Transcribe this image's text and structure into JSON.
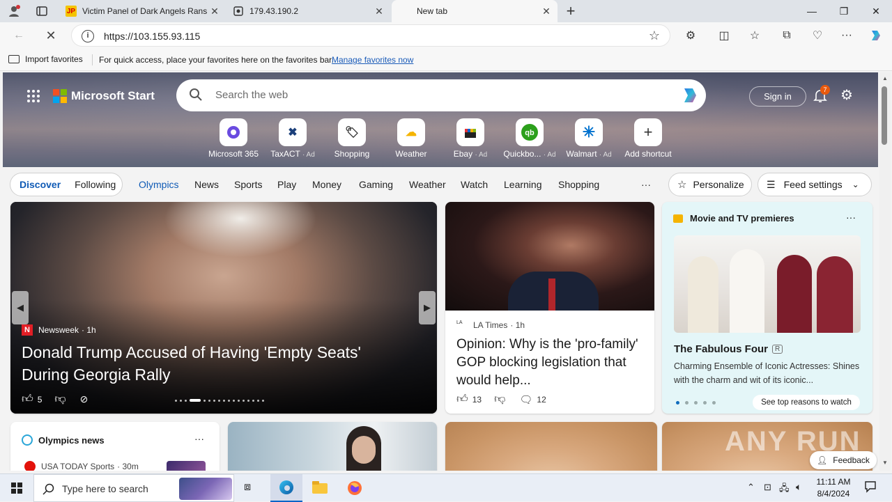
{
  "browser": {
    "tabs": [
      {
        "favicon": "JP",
        "title": "Victim Panel of Dark Angels Rans"
      },
      {
        "favicon": "site-icon",
        "title": "179.43.190.2"
      },
      {
        "favicon": "",
        "title": "New tab"
      }
    ],
    "new_tab_glyph": "+",
    "url": "https://103.155.93.115",
    "favbar": {
      "import_label": "Import favorites",
      "message": "For quick access, place your favorites here on the favorites bar.",
      "manage_link": "Manage favorites now"
    }
  },
  "start": {
    "brand": "Microsoft Start",
    "search_placeholder": "Search the web",
    "sign_in": "Sign in",
    "notification_count": "7",
    "quicklinks": [
      {
        "label": "Microsoft 365",
        "ad": ""
      },
      {
        "label": "TaxACT",
        "ad": "· Ad"
      },
      {
        "label": "Shopping",
        "ad": ""
      },
      {
        "label": "Weather",
        "ad": ""
      },
      {
        "label": "Ebay",
        "ad": "· Ad"
      },
      {
        "label": "Quickbo...",
        "ad": "· Ad"
      },
      {
        "label": "Walmart",
        "ad": "· Ad"
      },
      {
        "label": "Add shortcut",
        "ad": ""
      }
    ],
    "feed_tabs": {
      "discover": "Discover",
      "following": "Following"
    },
    "nav": [
      "Olympics",
      "News",
      "Sports",
      "Play",
      "Money",
      "Gaming",
      "Weather",
      "Watch",
      "Learning",
      "Shopping"
    ],
    "more": "···",
    "personalize": "Personalize",
    "feed_settings": "Feed settings"
  },
  "cards": {
    "main": {
      "source": "Newsweek",
      "age": "· 1h",
      "title": "Donald Trump Accused of Having 'Empty Seats' During Georgia Rally",
      "likes": "5"
    },
    "second": {
      "source": "LA Times",
      "age": "· 1h",
      "title": "Opinion: Why is the 'pro-family' GOP blocking legislation that would help...",
      "likes": "13",
      "comments": "12"
    },
    "premieres": {
      "header": "Movie and TV premieres",
      "title": "The Fabulous Four",
      "rating": "R",
      "desc": "Charming Ensemble of Iconic Actresses: Shines with the charm and wit of its iconic...",
      "cta": "See top reasons to watch",
      "more": "···"
    },
    "olympics": {
      "header": "Olympics news",
      "source": "USA TODAY Sports",
      "age": "· 30m",
      "more": "···"
    }
  },
  "feedback": "Feedback",
  "watermark": "ANY RUN",
  "taskbar": {
    "search_placeholder": "Type here to search",
    "time": "11:11 AM",
    "date": "8/4/2024"
  }
}
